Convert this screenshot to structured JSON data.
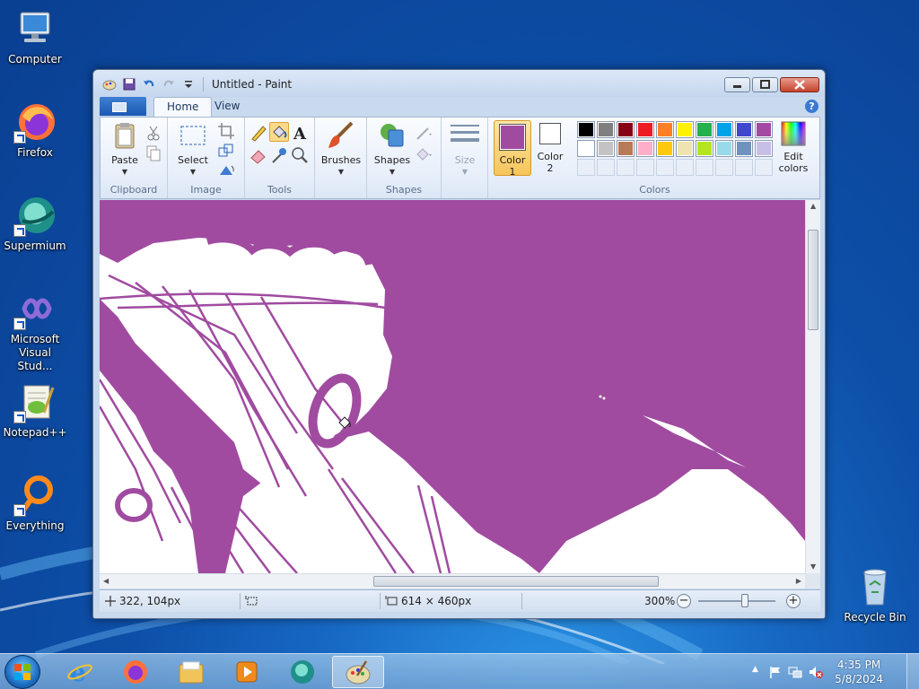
{
  "desktop": {
    "icons": [
      {
        "label": "Computer"
      },
      {
        "label": "Firefox"
      },
      {
        "label": "Supermium"
      },
      {
        "label": "Microsoft Visual Stud..."
      },
      {
        "label": "Notepad++"
      },
      {
        "label": "Everything"
      },
      {
        "label": "Recycle Bin"
      }
    ]
  },
  "window": {
    "title": "Untitled - Paint",
    "tabs": [
      {
        "label": "Home"
      },
      {
        "label": "View"
      }
    ],
    "ribbon": {
      "clipboard": {
        "paste": "Paste",
        "group": "Clipboard"
      },
      "image": {
        "select": "Select",
        "group": "Image"
      },
      "tools": {
        "group": "Tools"
      },
      "brushes": {
        "label": "Brushes"
      },
      "shapes": {
        "label": "Shapes",
        "group": "Shapes"
      },
      "size": {
        "label": "Size"
      },
      "color1": {
        "label_a": "Color",
        "label_b": "1",
        "value": "#a04ba0"
      },
      "color2": {
        "label_a": "Color",
        "label_b": "2",
        "value": "#ffffff"
      },
      "colors": {
        "group": "Colors"
      },
      "edit_colors": {
        "label_a": "Edit",
        "label_b": "colors"
      },
      "palette_row1": [
        "#000000",
        "#7f7f7f",
        "#880015",
        "#ed1c24",
        "#ff7f27",
        "#fff200",
        "#22b14c",
        "#00a2e8",
        "#3f48cc",
        "#a349a4"
      ],
      "palette_row2": [
        "#ffffff",
        "#c3c3c3",
        "#b97a57",
        "#ffaec9",
        "#ffc90e",
        "#efe4b0",
        "#b5e61d",
        "#99d9ea",
        "#7092be",
        "#c8bfe7"
      ]
    },
    "status": {
      "cursor_position": "322, 104px",
      "image_size": "614 × 460px",
      "zoom": "300%"
    }
  },
  "taskbar": {
    "time": "4:35 PM",
    "date": "5/8/2024"
  },
  "colors": {
    "canvas_purple": "#a04ba0"
  }
}
